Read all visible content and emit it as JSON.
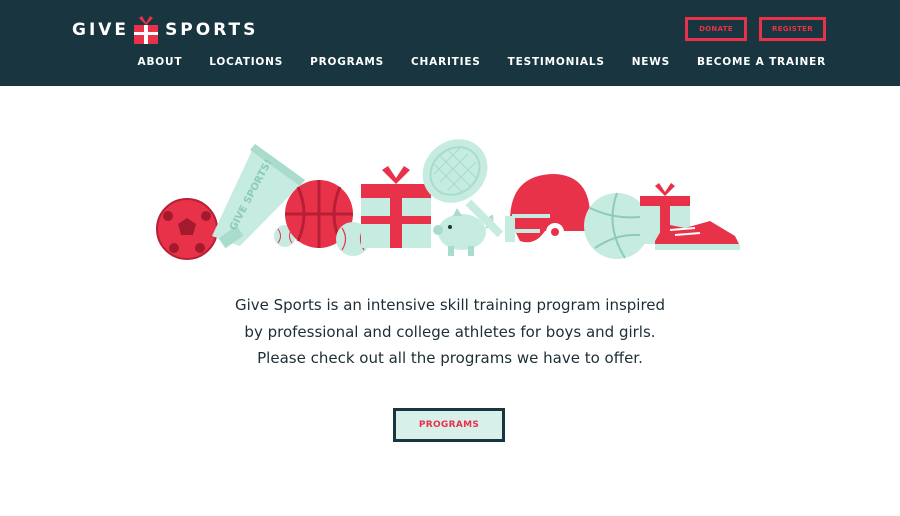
{
  "header": {
    "logo_left": "GIVE",
    "logo_right": "SPORTS",
    "donate_label": "DONATE",
    "register_label": "REGISTER",
    "nav": [
      {
        "label": "ABOUT"
      },
      {
        "label": "LOCATIONS"
      },
      {
        "label": "PROGRAMS"
      },
      {
        "label": "CHARITIES"
      },
      {
        "label": "TESTIMONIALS"
      },
      {
        "label": "NEWS"
      },
      {
        "label": "BECOME A TRAINER"
      }
    ]
  },
  "hero": {
    "megaphone_text": "GIVE SPORTS!"
  },
  "intro": {
    "lines": [
      "Give Sports is an intensive skill training program inspired",
      "by professional and college athletes for boys and girls.",
      "Please check out all the programs we have to offer."
    ]
  },
  "cta": {
    "label": "PROGRAMS"
  },
  "colors": {
    "header_bg": "#183540",
    "accent_red": "#e8324a",
    "mint": "#c6ebe0",
    "text_dark": "#1c2e36"
  }
}
